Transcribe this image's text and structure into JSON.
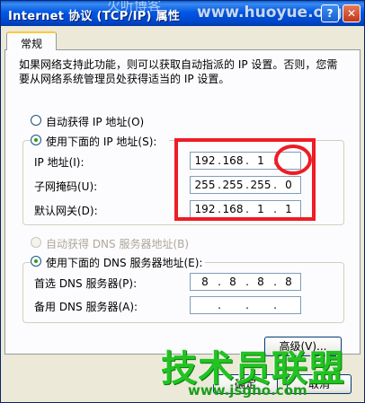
{
  "window": {
    "title": "Internet 协议 (TCP/IP) 属性",
    "help_glyph": "?",
    "close_glyph": "✕"
  },
  "watermark": {
    "top_url": "www.huoyue.org",
    "top_cn": "火听博客",
    "site_name": "技术员联盟",
    "site_url": "www.jsgho.com"
  },
  "tabs": [
    {
      "label": "常规"
    }
  ],
  "description": "如果网络支持此功能，则可以获取自动指派的 IP 设置。否则，您需要从网络系统管理员处获得适当的 IP 设置。",
  "ip": {
    "auto_label": "自动获得 IP 地址(O)",
    "auto_selected": false,
    "manual_label": "使用下面的 IP 地址(S):",
    "manual_selected": true,
    "fields": [
      {
        "label": "IP 地址(I):",
        "octets": [
          "192",
          "168",
          "1",
          ""
        ]
      },
      {
        "label": "子网掩码(U):",
        "octets": [
          "255",
          "255",
          "255",
          "0"
        ]
      },
      {
        "label": "默认网关(D):",
        "octets": [
          "192",
          "168",
          "1",
          "1"
        ]
      }
    ]
  },
  "dns": {
    "auto_label": "自动获得 DNS 服务器地址(B)",
    "auto_selected": false,
    "auto_disabled": true,
    "manual_label": "使用下面的 DNS 服务器地址(E):",
    "manual_selected": true,
    "fields": [
      {
        "label": "首选 DNS 服务器(P):",
        "octets": [
          "8",
          "8",
          "8",
          "8"
        ]
      },
      {
        "label": "备用 DNS 服务器(A):",
        "octets": [
          "",
          "",
          "",
          ""
        ]
      }
    ]
  },
  "buttons": {
    "advanced": "高级(V)...",
    "ok": "确定",
    "cancel": "取消"
  },
  "colors": {
    "highlight": "#ee1c24",
    "title_bar": "#0058e6",
    "watermark_green": "#22c322"
  }
}
